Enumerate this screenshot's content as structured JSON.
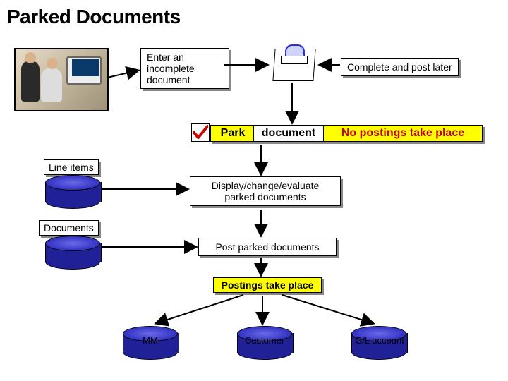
{
  "title": "Parked Documents",
  "boxes": {
    "enter_incomplete": "Enter an\nincomplete\ndocument",
    "complete_later": "Complete and post later",
    "park": "Park",
    "document": "document",
    "no_postings": "No postings take place",
    "line_items": "Line items",
    "documents": "Documents",
    "display_change": "Display/change/evaluate\nparked documents",
    "post_parked": "Post parked documents",
    "postings_take_place": "Postings take place"
  },
  "cylinders": {
    "mm": "MM",
    "customer": "Customer",
    "gl": "G/L account"
  },
  "icons": {
    "people": "people-at-computer",
    "clipboard": "clipboard-icon",
    "check": "checkmark-icon",
    "arrow": "flow-arrow"
  }
}
